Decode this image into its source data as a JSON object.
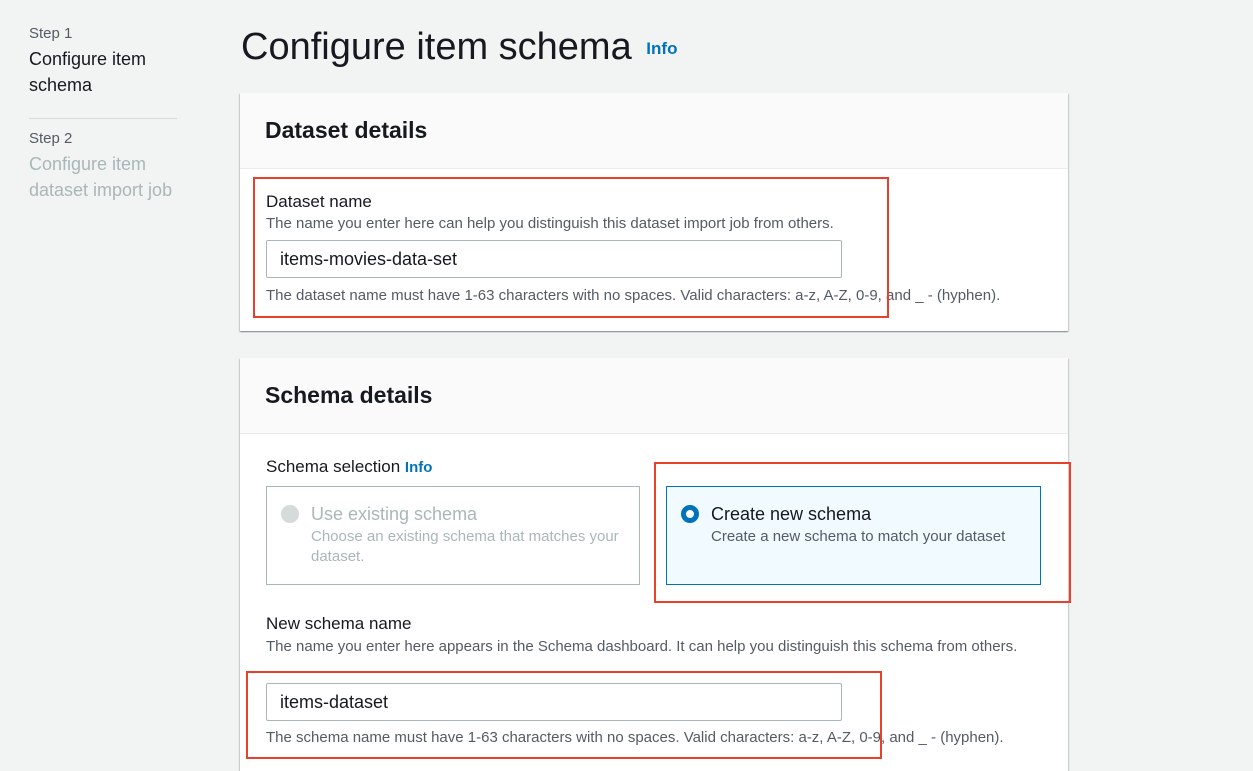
{
  "sidebar": {
    "steps": [
      {
        "number": "Step 1",
        "title": "Configure item schema"
      },
      {
        "number": "Step 2",
        "title": "Configure item dataset import job"
      }
    ]
  },
  "page": {
    "title": "Configure item schema",
    "info": "Info"
  },
  "dataset_details": {
    "heading": "Dataset details",
    "name_label": "Dataset name",
    "name_description": "The name you enter here can help you distinguish this dataset import job from others.",
    "name_value": "items-movies-data-set",
    "name_constraint": "The dataset name must have 1-63 characters with no spaces. Valid characters: a-z, A-Z, 0-9, and _ - (hyphen)."
  },
  "schema_details": {
    "heading": "Schema details",
    "selection_label": "Schema selection",
    "selection_info": "Info",
    "options": [
      {
        "title": "Use existing schema",
        "description": "Choose an existing schema that matches your dataset.",
        "state": "disabled"
      },
      {
        "title": "Create new schema",
        "description": "Create a new schema to match your dataset",
        "state": "selected"
      }
    ],
    "new_name_label": "New schema name",
    "new_name_description": "The name you enter here appears in the Schema dashboard. It can help you distinguish this schema from others.",
    "new_name_value": "items-dataset",
    "new_name_constraint": "The schema name must have 1-63 characters with no spaces. Valid characters: a-z, A-Z, 0-9, and _ - (hyphen)."
  },
  "colors": {
    "accent": "#0073bb",
    "highlight": "#e8402a",
    "background": "#f2f3f3"
  }
}
